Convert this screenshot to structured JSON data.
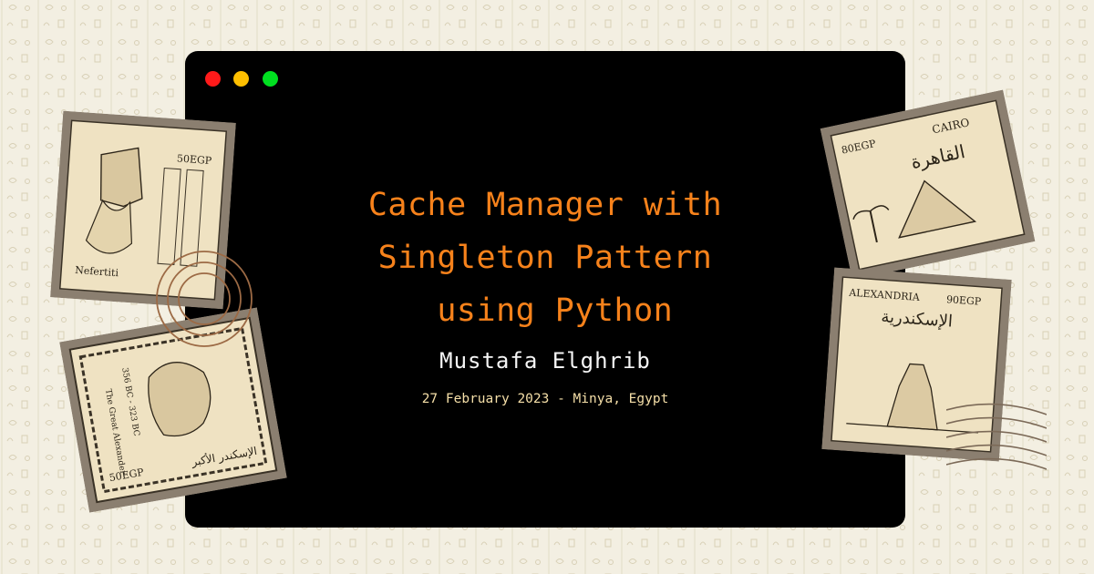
{
  "window": {
    "controls": [
      "close",
      "minimize",
      "maximize"
    ],
    "colors": {
      "close": "#ff1a1a",
      "minimize": "#ffbf00",
      "maximize": "#00e020"
    }
  },
  "title_lines": [
    "Cache Manager with",
    "Singleton Pattern",
    " using Python"
  ],
  "author": "Mustafa Elghrib",
  "dateline": "27 February 2023 - Minya, Egypt",
  "colors": {
    "title": "#f7821b",
    "author": "#f5f5f5",
    "dateline": "#f5dfa8",
    "background": "#f3efe2"
  },
  "stamps": {
    "nefertiti": {
      "name": "Nefertiti",
      "value": "50EGP"
    },
    "alexander": {
      "name": "The Great Alexander",
      "years": "356 BC - 323 BC",
      "arabic": "الإسكندر الأكبر",
      "value": "50EGP"
    },
    "cairo": {
      "city": "CAIRO",
      "arabic": "القاهرة",
      "value": "80EGP"
    },
    "alexandria": {
      "city": "ALEXANDRIA",
      "arabic": "الإسكندرية",
      "value": "90EGP"
    }
  }
}
